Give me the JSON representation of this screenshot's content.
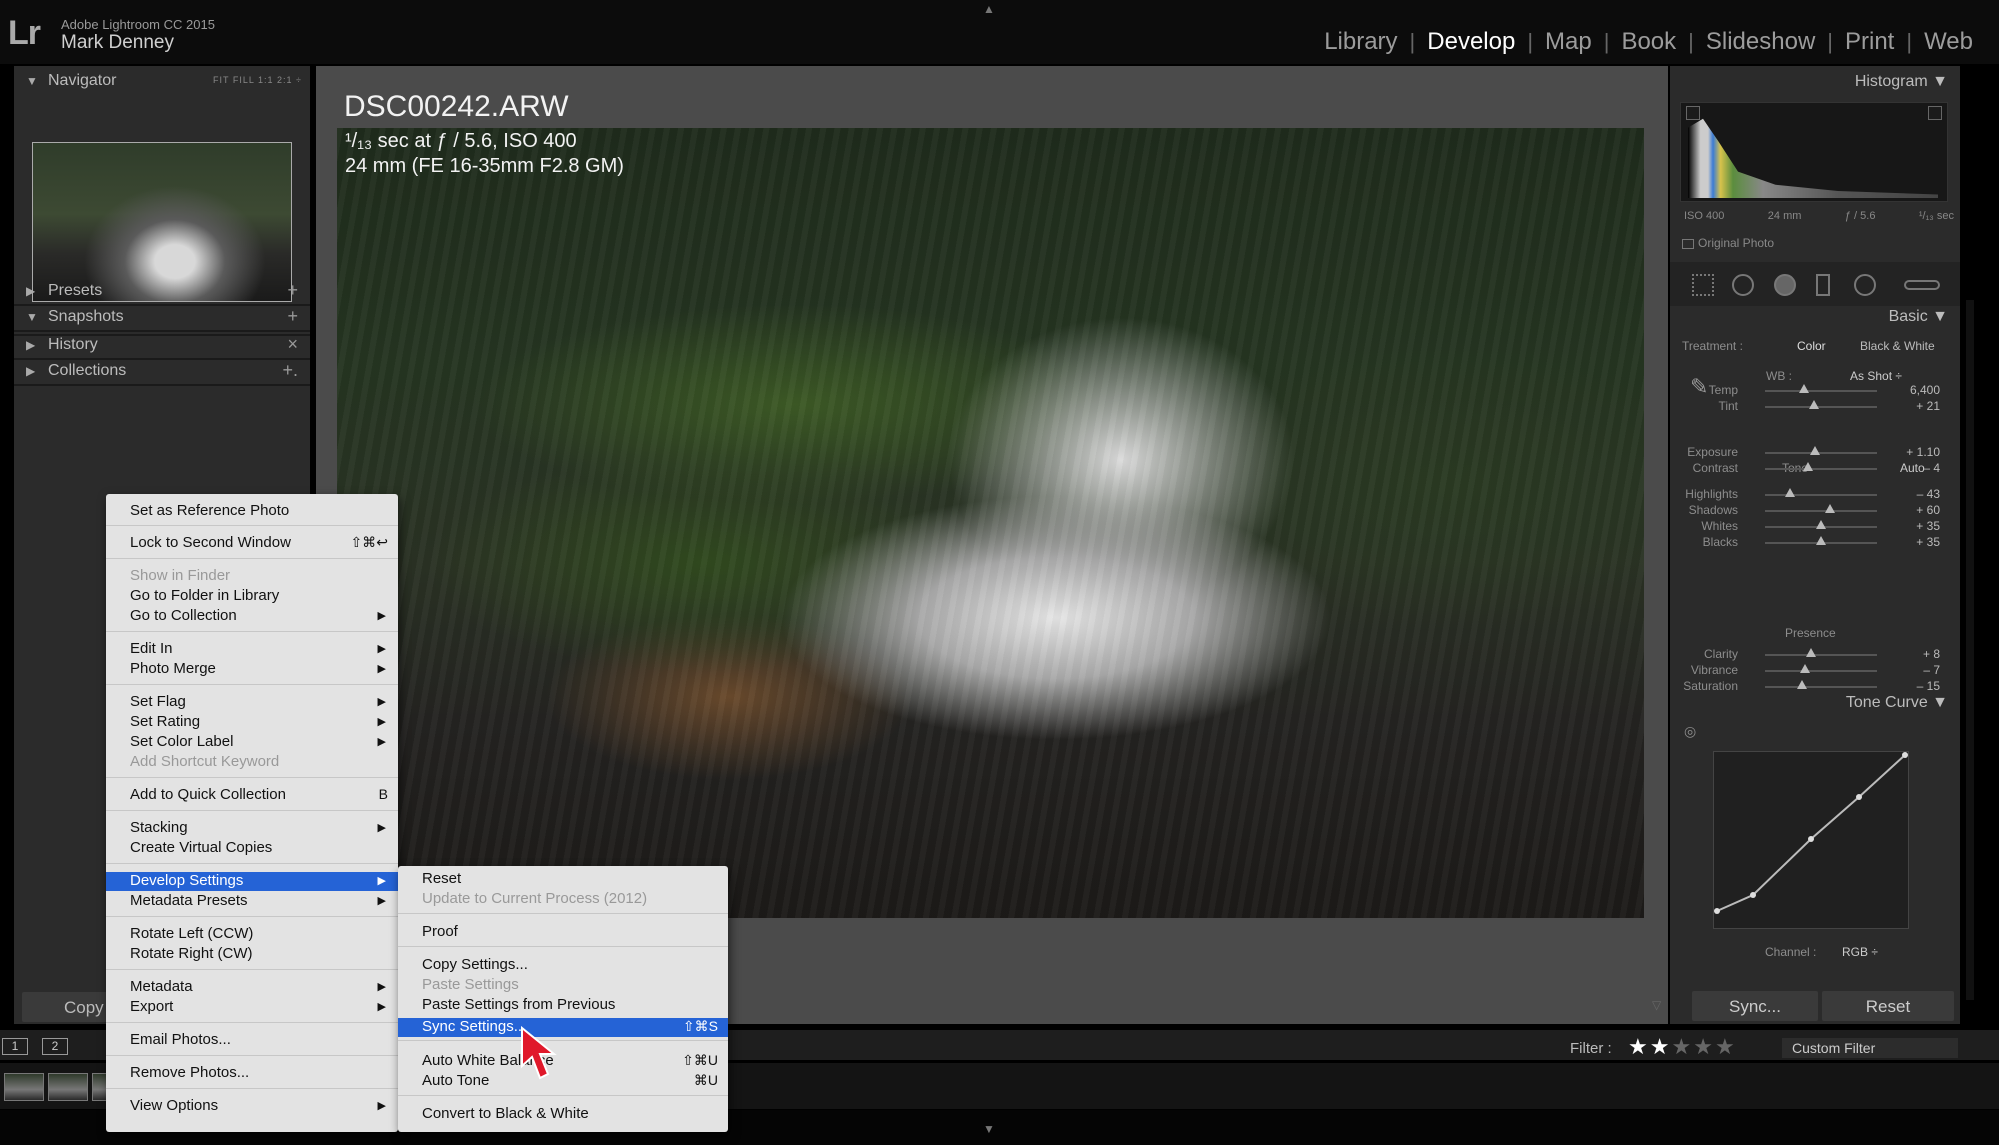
{
  "app": {
    "logo": "Lr",
    "name": "Adobe Lightroom CC 2015",
    "user": "Mark Denney",
    "modules": [
      "Library",
      "Develop",
      "Map",
      "Book",
      "Slideshow",
      "Print",
      "Web"
    ],
    "active_module": "Develop"
  },
  "left_panel": {
    "navigator": {
      "label": "Navigator",
      "zoom_options": "FIT  FILL  1:1  2:1 ÷"
    },
    "sections": [
      {
        "label": "Presets",
        "action": "+"
      },
      {
        "label": "Snapshots",
        "action": "+"
      },
      {
        "label": "History",
        "action": "×"
      },
      {
        "label": "Collections",
        "action": "+."
      }
    ],
    "copy_button": "Copy"
  },
  "photo": {
    "filename": "DSC00242.ARW",
    "exposure": "¹/₁₃ sec at ƒ / 5.6, ISO 400",
    "lens": "24 mm (FE 16-35mm F2.8 GM)"
  },
  "context_menu": {
    "items": [
      {
        "label": "Set as Reference Photo"
      },
      {
        "label": "Lock to Second Window",
        "shortcut": "⇧⌘↩"
      },
      {
        "label": "Show in Finder",
        "disabled": true
      },
      {
        "label": "Go to Folder in Library"
      },
      {
        "label": "Go to Collection",
        "submenu": true
      },
      {
        "label": "Edit In",
        "submenu": true
      },
      {
        "label": "Photo Merge",
        "submenu": true
      },
      {
        "label": "Set Flag",
        "submenu": true
      },
      {
        "label": "Set Rating",
        "submenu": true
      },
      {
        "label": "Set Color Label",
        "submenu": true
      },
      {
        "label": "Add Shortcut Keyword",
        "disabled": true
      },
      {
        "label": "Add to Quick Collection",
        "shortcut": "B"
      },
      {
        "label": "Stacking",
        "submenu": true
      },
      {
        "label": "Create Virtual Copies"
      },
      {
        "label": "Develop Settings",
        "submenu": true,
        "highlighted": true
      },
      {
        "label": "Metadata Presets",
        "submenu": true
      },
      {
        "label": "Rotate Left (CCW)"
      },
      {
        "label": "Rotate Right (CW)"
      },
      {
        "label": "Metadata",
        "submenu": true
      },
      {
        "label": "Export",
        "submenu": true
      },
      {
        "label": "Email Photos..."
      },
      {
        "label": "Remove Photos..."
      },
      {
        "label": "View Options",
        "submenu": true
      }
    ]
  },
  "submenu": {
    "items": [
      {
        "label": "Reset"
      },
      {
        "label": "Update to Current Process (2012)",
        "disabled": true
      },
      {
        "label": "Proof"
      },
      {
        "label": "Copy Settings..."
      },
      {
        "label": "Paste Settings",
        "disabled": true
      },
      {
        "label": "Paste Settings from Previous"
      },
      {
        "label": "Sync Settings...",
        "shortcut": "⇧⌘S",
        "highlighted": true
      },
      {
        "label": "Auto White Balance",
        "shortcut": "⇧⌘U"
      },
      {
        "label": "Auto Tone",
        "shortcut": "⌘U"
      },
      {
        "label": "Convert to Black & White"
      }
    ]
  },
  "right_panel": {
    "histogram_title": "Histogram",
    "histogram_info": [
      "ISO 400",
      "24 mm",
      "ƒ / 5.6",
      "¹/₁₃ sec"
    ],
    "original_photo": "Original Photo",
    "basic_title": "Basic",
    "treatment_label": "Treatment :",
    "treatment_color": "Color",
    "treatment_bw": "Black & White",
    "wb_label": "WB :",
    "wb_value": "As Shot ÷",
    "tone_label": "Tone",
    "auto_label": "Auto",
    "presence_label": "Presence",
    "sliders": [
      {
        "label": "Temp",
        "value": "6,400",
        "pos": 0.35
      },
      {
        "label": "Tint",
        "value": "+ 21",
        "pos": 0.44
      },
      {
        "label": "Exposure",
        "value": "+ 1.10",
        "pos": 0.45
      },
      {
        "label": "Contrast",
        "value": "– 4",
        "pos": 0.38
      },
      {
        "label": "Highlights",
        "value": "– 43",
        "pos": 0.22
      },
      {
        "label": "Shadows",
        "value": "+ 60",
        "pos": 0.58
      },
      {
        "label": "Whites",
        "value": "+ 35",
        "pos": 0.5
      },
      {
        "label": "Blacks",
        "value": "+ 35",
        "pos": 0.5
      },
      {
        "label": "Clarity",
        "value": "+ 8",
        "pos": 0.41
      },
      {
        "label": "Vibrance",
        "value": "– 7",
        "pos": 0.36
      },
      {
        "label": "Saturation",
        "value": "– 15",
        "pos": 0.33
      }
    ],
    "tone_curve_title": "Tone Curve",
    "channel_label": "Channel :",
    "channel_value": "RGB ÷",
    "sync_button": "Sync...",
    "reset_button": "Reset"
  },
  "filmstrip": {
    "view_buttons": [
      "1",
      "2"
    ],
    "filter_label": "Filter :",
    "filter_stars": 2,
    "filter_total_stars": 5,
    "custom_filter": "Custom Filter"
  }
}
